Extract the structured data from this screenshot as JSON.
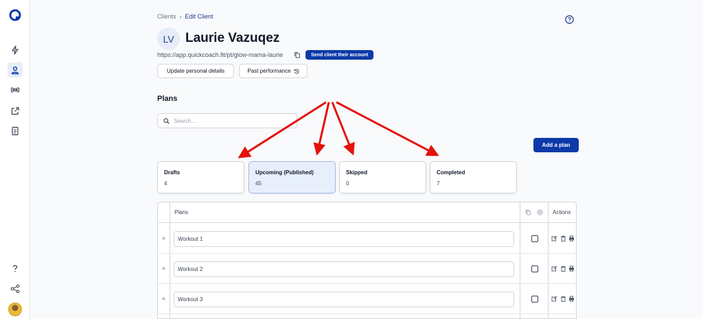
{
  "colors": {
    "primary": "#0b3aa8",
    "arrow": "#e3120b",
    "selected_card": "#e8effc"
  },
  "sidebar": {
    "icons": [
      "quickcoach-logo-icon",
      "lightning-icon",
      "user-icon",
      "dumbbell-icon",
      "external-link-icon",
      "document-icon",
      "help-icon",
      "share-icon",
      "user-avatar"
    ]
  },
  "breadcrumb": {
    "parent": "Clients",
    "separator": "›",
    "current": "Edit Client"
  },
  "client": {
    "initials": "LV",
    "name": "Laurie Vazuqez",
    "url": "https://app.quickcoach.fit/pt/glow-mama-laurie",
    "send_button": "Send client their account",
    "update_button": "Update personal details",
    "performance_button": "Past performance"
  },
  "plans": {
    "heading": "Plans",
    "search_placeholder": "Search...",
    "add_button": "Add a plan",
    "stats": [
      {
        "label": "Drafts",
        "count": "4"
      },
      {
        "label": "Upcoming (Published)",
        "count": "45"
      },
      {
        "label": "Skipped",
        "count": "0"
      },
      {
        "label": "Completed",
        "count": "7"
      }
    ],
    "selected_stat": "Upcoming (Published)",
    "table": {
      "col_plans": "Plans",
      "col_actions": "Actions",
      "rows": [
        {
          "name": "Workout 1"
        },
        {
          "name": "Workout 2"
        },
        {
          "name": "Workout 3"
        }
      ]
    }
  }
}
